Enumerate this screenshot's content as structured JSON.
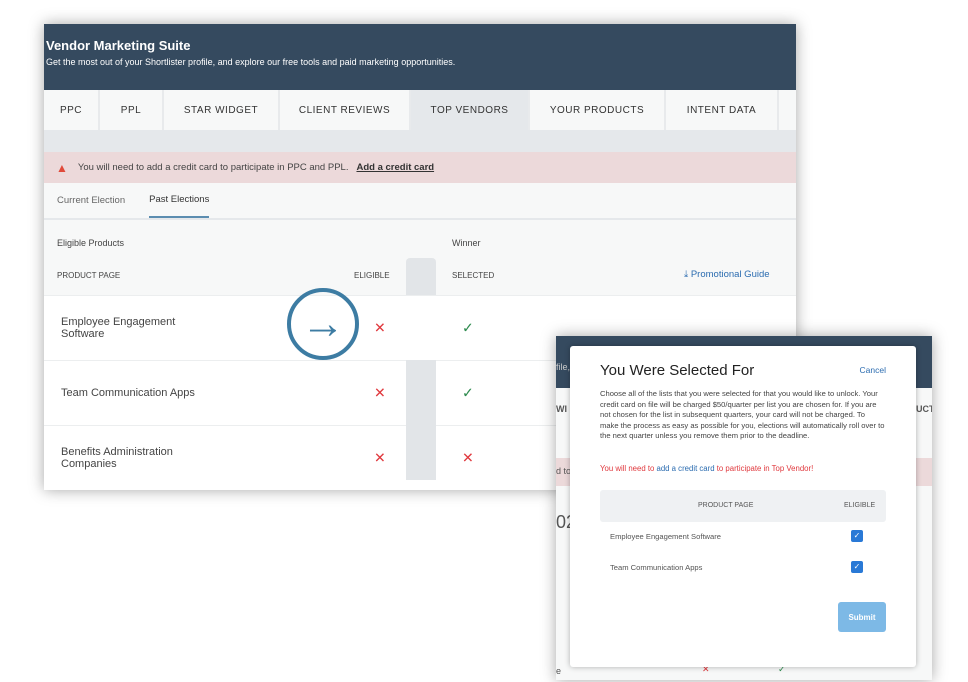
{
  "header": {
    "title": "Vendor Marketing Suite",
    "subtitle": "Get the most out of your Shortlister profile, and explore our free tools and paid marketing opportunities."
  },
  "tabs": [
    {
      "label": "PPC"
    },
    {
      "label": "PPL"
    },
    {
      "label": "STAR WIDGET"
    },
    {
      "label": "CLIENT REVIEWS"
    },
    {
      "label": "TOP VENDORS",
      "active": true
    },
    {
      "label": "YOUR PRODUCTS"
    },
    {
      "label": "INTENT DATA"
    }
  ],
  "alert": {
    "text": "You will need to add a credit card to participate in PPC and PPL.",
    "link": "Add a credit card",
    "icon": "warning-icon"
  },
  "subtabs": [
    {
      "label": "Current Election"
    },
    {
      "label": "Past Elections",
      "active": true
    }
  ],
  "table": {
    "group1": "Eligible Products",
    "group2": "Winner",
    "col_product": "PRODUCT PAGE",
    "col_eligible": "ELIGIBLE",
    "col_selected": "SELECTED",
    "guide_link": "Promotional Guide",
    "rows": [
      {
        "name": "Employee Engagement Software",
        "eligible": false,
        "selected": true
      },
      {
        "name": "Team Communication Apps",
        "eligible": false,
        "selected": true
      },
      {
        "name": "Benefits Administration Companies",
        "eligible": false,
        "selected": false
      }
    ]
  },
  "background_fragments": {
    "a": "file,",
    "b": "WI",
    "c": "UCT",
    "d": "d to",
    "e": "02",
    "f": "e"
  },
  "modal": {
    "title": "You Were Selected For",
    "cancel": "Cancel",
    "description": "Choose all of the lists that you were selected for that you would like to unlock. Your credit card on file will be charged $50/quarter per list you are chosen for. If you are not chosen for the list in subsequent quarters, your card will not be charged. To make the process as easy as possible for you, elections will automatically roll over to the next quarter unless you remove them prior to the deadline.",
    "warn_pre": "You will need to ",
    "warn_link": "add a credit card",
    "warn_post": " to participate in Top Vendor!",
    "col_product": "PRODUCT PAGE",
    "col_eligible": "ELIGIBLE",
    "rows": [
      {
        "name": "Employee Engagement Software",
        "checked": true
      },
      {
        "name": "Team Communication Apps",
        "checked": true
      }
    ],
    "submit": "Submit"
  },
  "colors": {
    "header": "#354a5f",
    "accent": "#3d7ca3",
    "error": "#e0393e",
    "success": "#2e8b4e",
    "checkbox": "#2979d6"
  }
}
